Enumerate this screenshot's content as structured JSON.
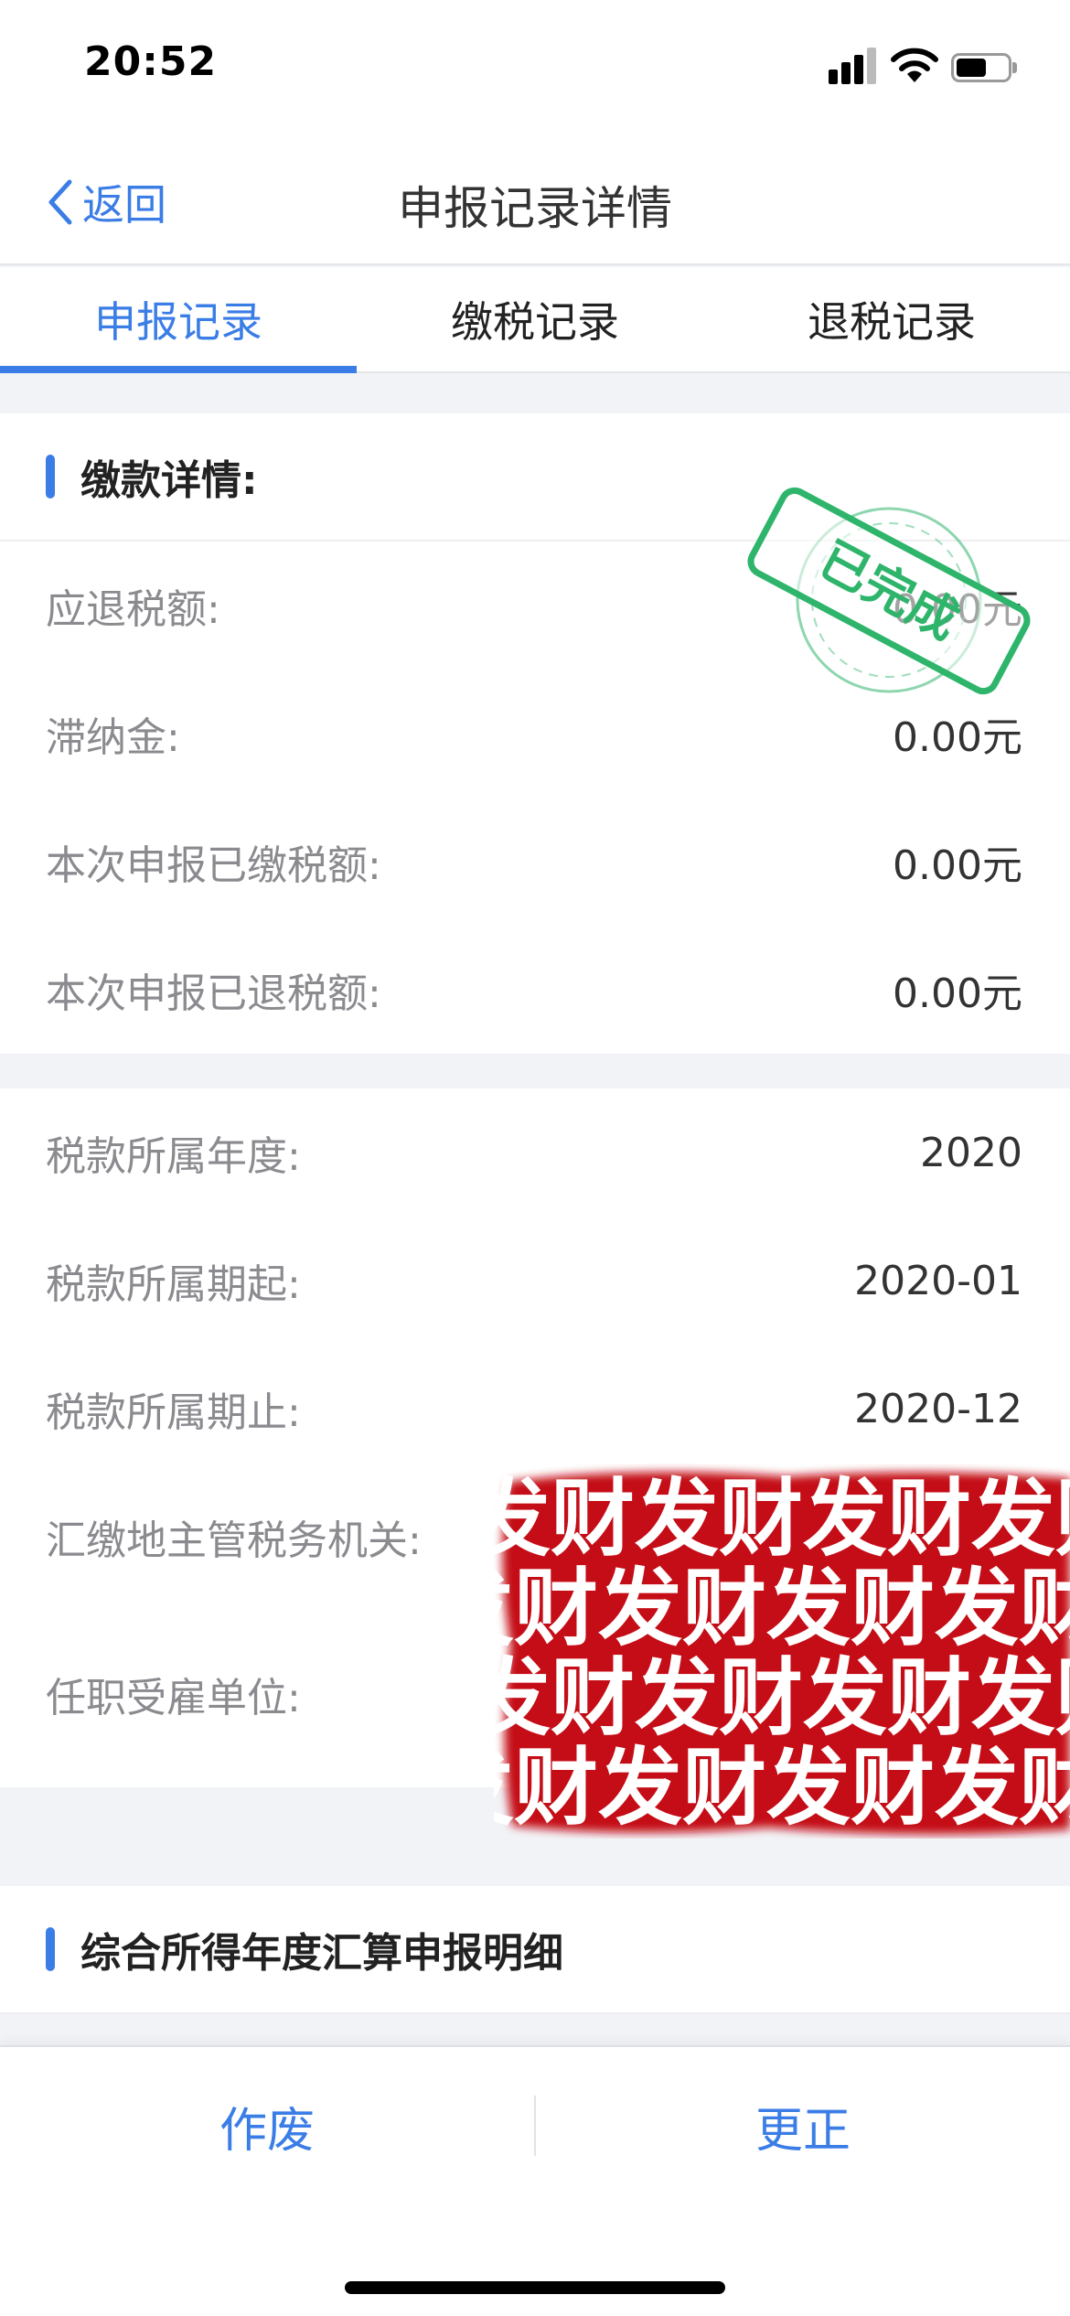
{
  "status_bar": {
    "time": "20:52"
  },
  "nav": {
    "back_label": "返回",
    "title": "申报记录详情"
  },
  "tabs": [
    {
      "label": "申报记录",
      "active": true
    },
    {
      "label": "缴税记录",
      "active": false
    },
    {
      "label": "退税记录",
      "active": false
    }
  ],
  "payment_section": {
    "title": "缴款详情:",
    "stamp_text": "已完成",
    "rows": [
      {
        "label": "应退税额:",
        "value": "0.00元"
      },
      {
        "label": "滞纳金:",
        "value": "0.00元"
      },
      {
        "label": "本次申报已缴税额:",
        "value": "0.00元"
      },
      {
        "label": "本次申报已退税额:",
        "value": "0.00元"
      }
    ]
  },
  "tax_section": {
    "rows": [
      {
        "label": "税款所属年度:",
        "value": "2020"
      },
      {
        "label": "税款所属期起:",
        "value": "2020-01"
      },
      {
        "label": "税款所属期止:",
        "value": "2020-12"
      },
      {
        "label": "汇缴地主管税务机关:",
        "value": ""
      },
      {
        "label": "任职受雇单位:",
        "value": ""
      }
    ],
    "redaction_text": "发财"
  },
  "detail_section": {
    "title": "综合所得年度汇算申报明细"
  },
  "bottom_actions": {
    "void_label": "作废",
    "correct_label": "更正"
  },
  "colors": {
    "accent": "#3b7de6",
    "stamp": "#2fb56b",
    "redaction": "#c40d14"
  }
}
